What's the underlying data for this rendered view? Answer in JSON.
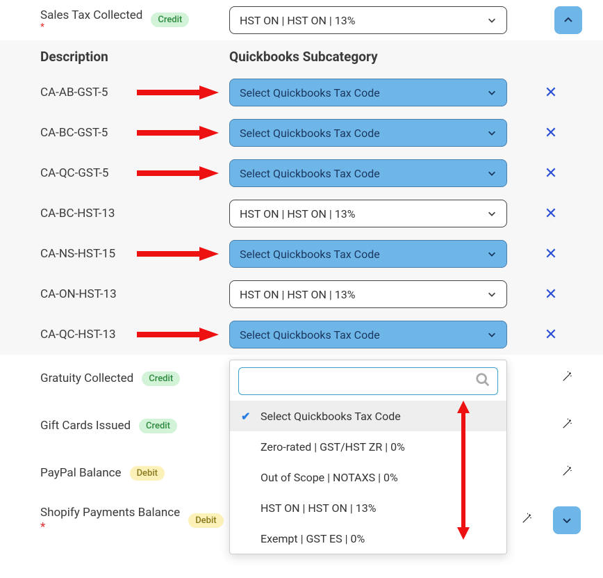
{
  "top": {
    "label": "Sales Tax Collected",
    "required": true,
    "badge": "Credit",
    "selectText": "HST ON | HST ON | 13%"
  },
  "headers": {
    "desc": "Description",
    "sub": "Quickbooks Subcategory"
  },
  "taxRows": [
    {
      "desc": "CA-AB-GST-5",
      "selectText": "Select Quickbooks Tax Code",
      "blue": true,
      "arrow": true
    },
    {
      "desc": "CA-BC-GST-5",
      "selectText": "Select Quickbooks Tax Code",
      "blue": true,
      "arrow": true
    },
    {
      "desc": "CA-QC-GST-5",
      "selectText": "Select Quickbooks Tax Code",
      "blue": true,
      "arrow": true
    },
    {
      "desc": "CA-BC-HST-13",
      "selectText": "HST ON | HST ON | 13%",
      "blue": false,
      "arrow": false
    },
    {
      "desc": "CA-NS-HST-15",
      "selectText": "Select Quickbooks Tax Code",
      "blue": true,
      "arrow": true
    },
    {
      "desc": "CA-ON-HST-13",
      "selectText": "HST ON | HST ON | 13%",
      "blue": false,
      "arrow": false
    },
    {
      "desc": "CA-QC-HST-13",
      "selectText": "Select Quickbooks Tax Code",
      "blue": true,
      "arrow": true
    }
  ],
  "dropdown": {
    "searchValue": "",
    "options": [
      {
        "label": "Select Quickbooks Tax Code",
        "selected": true
      },
      {
        "label": "Zero-rated | GST/HST ZR | 0%",
        "selected": false
      },
      {
        "label": "Out of Scope | NOTAXS | 0%",
        "selected": false
      },
      {
        "label": "HST ON | HST ON | 13%",
        "selected": false
      },
      {
        "label": "Exempt | GST ES | 0%",
        "selected": false
      }
    ]
  },
  "acctRows": [
    {
      "label": "Gratuity Collected",
      "badge": "Credit",
      "required": false,
      "showExpand": false
    },
    {
      "label": "Gift Cards Issued",
      "badge": "Credit",
      "required": false,
      "showExpand": false
    },
    {
      "label": "PayPal Balance",
      "badge": "Debit",
      "required": false,
      "showExpand": false
    },
    {
      "label": "Shopify Payments Balance",
      "badge": "Debit",
      "required": true,
      "showExpand": true
    }
  ]
}
